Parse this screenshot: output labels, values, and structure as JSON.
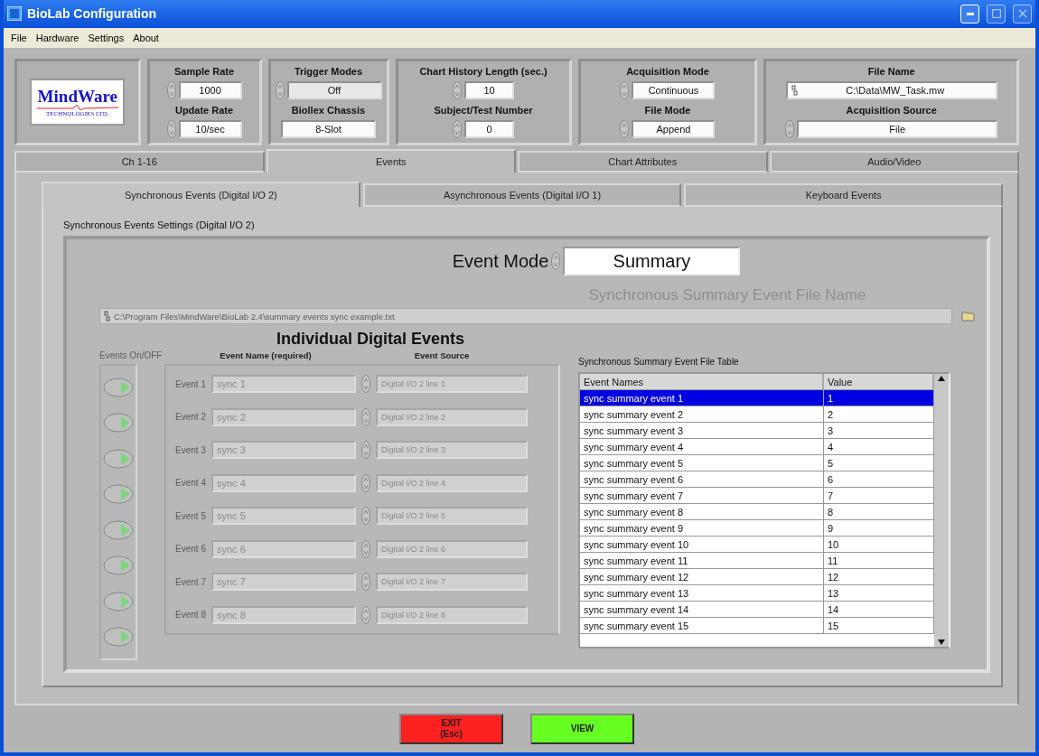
{
  "window": {
    "title": "BioLab Configuration"
  },
  "menu": [
    "File",
    "Hardware",
    "Settings",
    "About"
  ],
  "logo": {
    "name": "MindWare",
    "tagline": "TECHNOLOGIES LTD."
  },
  "header_groups": [
    {
      "rows": [
        {
          "label": "Sample Rate",
          "value": "1000",
          "kind": "ring"
        },
        {
          "label": "Update Rate",
          "value": "10/sec",
          "kind": "ring"
        }
      ]
    },
    {
      "rows": [
        {
          "label": "Trigger Modes",
          "value": "Off",
          "kind": "ring",
          "disabled": true
        },
        {
          "label": "Biollex Chassis",
          "value": "8-Slot",
          "kind": "plain",
          "disabled": false
        }
      ]
    },
    {
      "rows": [
        {
          "label": "Chart History Length (sec.)",
          "value": "10",
          "kind": "ring"
        },
        {
          "label": "Subject/Test Number",
          "value": "0",
          "kind": "ring"
        }
      ]
    },
    {
      "rows": [
        {
          "label": "Acquisition Mode",
          "value": "Continuous",
          "kind": "ring"
        },
        {
          "label": "File Mode",
          "value": "Append",
          "kind": "ring"
        }
      ]
    },
    {
      "rows": [
        {
          "label": "File Name",
          "value": "C:\\Data\\MW_Task.mw",
          "kind": "path"
        },
        {
          "label": "Acquisition Source",
          "value": "File",
          "kind": "ring"
        }
      ]
    }
  ],
  "tabs": [
    {
      "label": "Ch 1-16",
      "selected": false
    },
    {
      "label": "Events",
      "selected": true
    },
    {
      "label": "Chart Attributes",
      "selected": false
    },
    {
      "label": "Audio/Video",
      "selected": false
    }
  ],
  "subtabs": [
    {
      "label": "Synchronous Events (Digital I/O 2)",
      "selected": true
    },
    {
      "label": "Asynchronous Events (Digital I/O 1)",
      "selected": false
    },
    {
      "label": "Keyboard Events",
      "selected": false
    }
  ],
  "section_label": "Synchronous Events Settings (Digital I/O 2)",
  "event_mode": {
    "label": "Event Mode",
    "value": "Summary"
  },
  "summary_file": {
    "label": "Synchronous Summary Event File Name",
    "value": "C:\\Program Files\\MindWare\\BioLab 2.4\\summary events sync example.txt"
  },
  "digital_events": {
    "title": "Individual Digital Events",
    "onoff_label": "Events On/OFF",
    "name_header": "Event Name (required)",
    "source_header": "Event Source",
    "disabled": true,
    "events": [
      {
        "label": "Event 1",
        "name": "sync 1",
        "source": "Digital I/O 2 line 1"
      },
      {
        "label": "Event 2",
        "name": "sync 2",
        "source": "Digital I/O 2 line 2"
      },
      {
        "label": "Event 3",
        "name": "sync 3",
        "source": "Digital I/O 2 line 3"
      },
      {
        "label": "Event 4",
        "name": "sync 4",
        "source": "Digital I/O 2 line 4"
      },
      {
        "label": "Event 5",
        "name": "sync 5",
        "source": "Digital I/O 2 line 5"
      },
      {
        "label": "Event 6",
        "name": "sync 6",
        "source": "Digital I/O 2 line 6"
      },
      {
        "label": "Event 7",
        "name": "sync 7",
        "source": "Digital I/O 2 line 7"
      },
      {
        "label": "Event 8",
        "name": "sync 8",
        "source": "Digital I/O 2 line 8"
      }
    ]
  },
  "summary_table": {
    "title": "Synchronous Summary Event File Table",
    "columns": [
      "Event Names",
      "Value"
    ],
    "rows": [
      {
        "cells": [
          "sync summary event 1",
          "1"
        ],
        "selected": true
      },
      {
        "cells": [
          "sync summary event 2",
          "2"
        ],
        "selected": false
      },
      {
        "cells": [
          "sync summary event 3",
          "3"
        ],
        "selected": false
      },
      {
        "cells": [
          "sync summary event 4",
          "4"
        ],
        "selected": false
      },
      {
        "cells": [
          "sync summary event 5",
          "5"
        ],
        "selected": false
      },
      {
        "cells": [
          "sync summary event 6",
          "6"
        ],
        "selected": false
      },
      {
        "cells": [
          "sync summary event 7",
          "7"
        ],
        "selected": false
      },
      {
        "cells": [
          "sync summary event 8",
          "8"
        ],
        "selected": false
      },
      {
        "cells": [
          "sync summary event 9",
          "9"
        ],
        "selected": false
      },
      {
        "cells": [
          "sync summary event 10",
          "10"
        ],
        "selected": false
      },
      {
        "cells": [
          "sync summary event 11",
          "11"
        ],
        "selected": false
      },
      {
        "cells": [
          "sync summary event 12",
          "12"
        ],
        "selected": false
      },
      {
        "cells": [
          "sync summary event 13",
          "13"
        ],
        "selected": false
      },
      {
        "cells": [
          "sync summary event 14",
          "14"
        ],
        "selected": false
      },
      {
        "cells": [
          "sync summary event 15",
          "15"
        ],
        "selected": false
      }
    ]
  },
  "buttons": [
    {
      "label": "EXIT\n(Esc)",
      "color": "#ff2020"
    },
    {
      "label": "VIEW",
      "color": "#66ff22"
    }
  ]
}
